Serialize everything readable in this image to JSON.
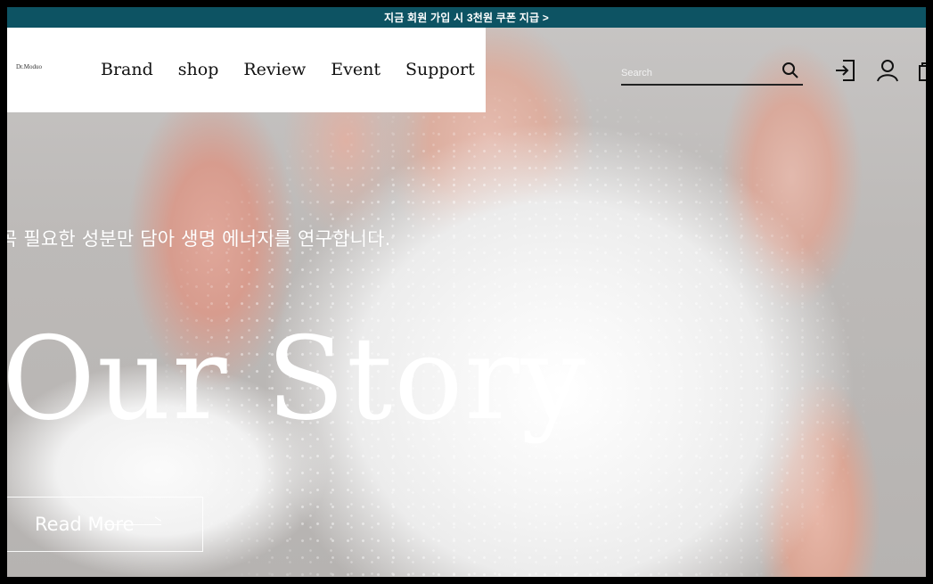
{
  "banner": {
    "text": "지금 회원 가입 시 3천원 쿠폰 지급 >"
  },
  "logo": {
    "text": "Dr.Moduo"
  },
  "nav": {
    "items": [
      "Brand",
      "shop",
      "Review",
      "Event",
      "Support"
    ]
  },
  "search": {
    "placeholder": "Search"
  },
  "icons": {
    "search": "search-icon",
    "login": "login-icon",
    "user": "user-icon",
    "cart": "cart-icon"
  },
  "hero": {
    "subtitle": "곡 필요한 성분만 담아 생명 에너지를 연구합니다.",
    "title": "Our Story",
    "button": "Read More"
  },
  "colors": {
    "banner": "#0d5363",
    "text_light": "#ffffff",
    "text_dark": "#111111"
  }
}
